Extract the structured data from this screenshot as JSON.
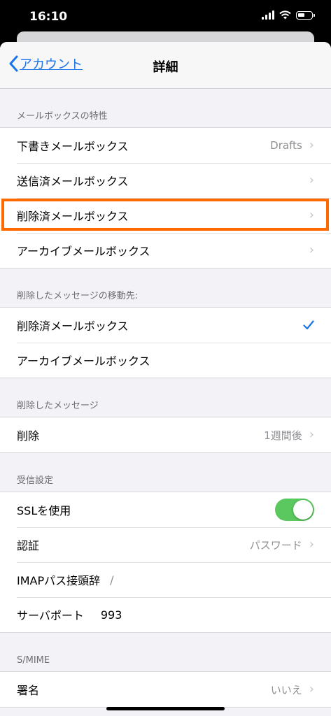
{
  "status_bar": {
    "time": "16:10"
  },
  "nav": {
    "back_label": "アカウント",
    "title": "詳細"
  },
  "sections": {
    "mailbox_behaviors": {
      "header": "メールボックスの特性",
      "drafts": {
        "label": "下書きメールボックス",
        "value": "Drafts"
      },
      "sent": {
        "label": "送信済メールボックス"
      },
      "deleted": {
        "label": "削除済メールボックス"
      },
      "archive": {
        "label": "アーカイブメールボックス"
      }
    },
    "move_discarded": {
      "header": "削除したメッセージの移動先:",
      "deleted": {
        "label": "削除済メールボックス"
      },
      "archive": {
        "label": "アーカイブメールボックス"
      }
    },
    "deleted_messages": {
      "header": "削除したメッセージ",
      "remove": {
        "label": "削除",
        "value": "1週間後"
      }
    },
    "incoming": {
      "header": "受信設定",
      "ssl": {
        "label": "SSLを使用",
        "enabled": true
      },
      "auth": {
        "label": "認証",
        "value": "パスワード"
      },
      "imap_prefix": {
        "label": "IMAPパス接頭辞",
        "value": "/"
      },
      "server_port": {
        "label": "サーバポート",
        "value": "993"
      }
    },
    "smime": {
      "header": "S/MIME",
      "sign": {
        "label": "署名",
        "value": "いいえ"
      }
    }
  },
  "colors": {
    "accent": "#1a73e8",
    "toggle_on": "#5ac85e",
    "highlight": "#ff6a00"
  }
}
